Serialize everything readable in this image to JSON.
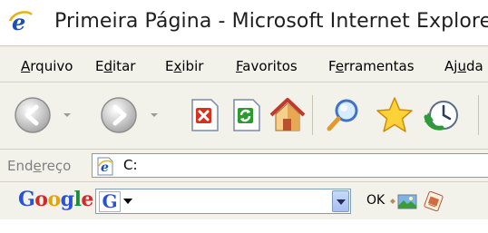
{
  "window": {
    "title": "Primeira Página - Microsoft Internet Explorer",
    "title_icon": "ie-logo-icon"
  },
  "menu": {
    "items": [
      {
        "pre": "",
        "acc": "A",
        "post": "rquivo"
      },
      {
        "pre": "E",
        "acc": "d",
        "post": "itar"
      },
      {
        "pre": "E",
        "acc": "x",
        "post": "ibir"
      },
      {
        "pre": "",
        "acc": "F",
        "post": "avoritos"
      },
      {
        "pre": "F",
        "acc": "e",
        "post": "rramentas"
      },
      {
        "pre": "Aj",
        "acc": "u",
        "post": "da"
      }
    ]
  },
  "toolbar": {
    "buttons": [
      "back-icon",
      "forward-icon",
      "stop-icon",
      "refresh-icon",
      "home-icon",
      "search-icon",
      "favorites-icon",
      "history-icon"
    ]
  },
  "address": {
    "label_pre": "End",
    "label_acc": "e",
    "label_post": "reço",
    "value": "C:"
  },
  "google": {
    "logo": [
      "G",
      "o",
      "o",
      "g",
      "l",
      "e"
    ],
    "search_icon_letter": "G",
    "ok_label": "OK"
  },
  "colors": {
    "toolbar_bg": "#f3f2ea",
    "address_border": "#7f9db9",
    "google_blue": "#2953d6",
    "google_red": "#cf2a27",
    "google_yellow": "#e3a30f",
    "google_green": "#1a8f3a"
  }
}
